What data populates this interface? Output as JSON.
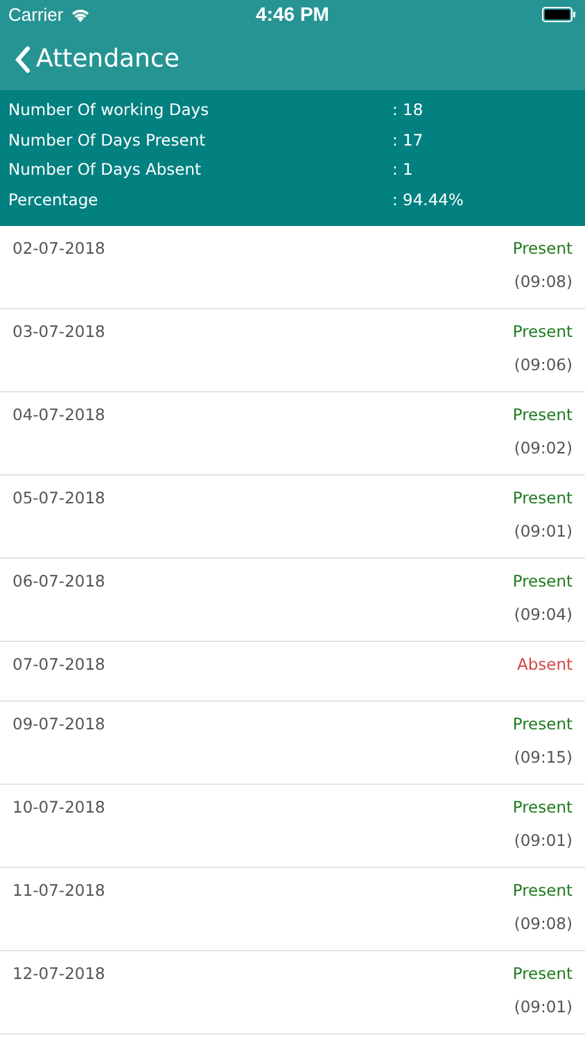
{
  "status_bar": {
    "carrier": "Carrier",
    "time": "4:46 PM"
  },
  "nav": {
    "title": "Attendance"
  },
  "summary": [
    {
      "label": "Number Of working Days",
      "value": ": 18"
    },
    {
      "label": "Number Of Days Present",
      "value": ": 17"
    },
    {
      "label": "Number Of Days Absent",
      "value": ": 1"
    },
    {
      "label": "Percentage",
      "value": ": 94.44%"
    }
  ],
  "records": [
    {
      "date": "02-07-2018",
      "kind": "present",
      "status": "Present",
      "time": "(09:08)"
    },
    {
      "date": "03-07-2018",
      "kind": "present",
      "status": "Present",
      "time": "(09:06)"
    },
    {
      "date": "04-07-2018",
      "kind": "present",
      "status": "Present",
      "time": "(09:02)"
    },
    {
      "date": "05-07-2018",
      "kind": "present",
      "status": "Present",
      "time": "(09:01)"
    },
    {
      "date": "06-07-2018",
      "kind": "present",
      "status": "Present",
      "time": "(09:04)"
    },
    {
      "date": "07-07-2018",
      "kind": "absent",
      "status": "Absent"
    },
    {
      "date": "09-07-2018",
      "kind": "present",
      "status": "Present",
      "time": "(09:15)"
    },
    {
      "date": "10-07-2018",
      "kind": "present",
      "status": "Present",
      "time": "(09:01)"
    },
    {
      "date": "11-07-2018",
      "kind": "present",
      "status": "Present",
      "time": "(09:08)"
    },
    {
      "date": "12-07-2018",
      "kind": "present",
      "status": "Present",
      "time": "(09:01)"
    }
  ]
}
